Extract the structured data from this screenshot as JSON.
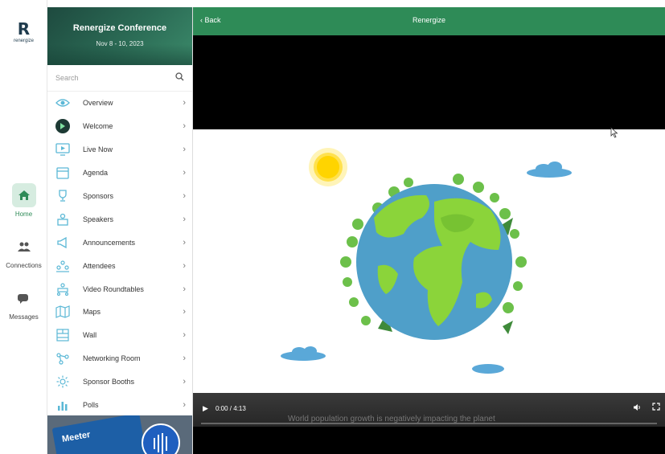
{
  "rail": {
    "logo_text": "renergize",
    "items": [
      {
        "label": "Home",
        "icon": "home-icon"
      },
      {
        "label": "Connections",
        "icon": "people-icon"
      },
      {
        "label": "Messages",
        "icon": "chat-icon"
      }
    ]
  },
  "panel": {
    "event_title": "Renergize Conference",
    "event_dates": "Nov 8 - 10, 2023",
    "search_placeholder": "Search",
    "menu": [
      {
        "label": "Overview",
        "icon": "eye-icon"
      },
      {
        "label": "Welcome",
        "icon": "welcome-logo-icon"
      },
      {
        "label": "Live Now",
        "icon": "monitor-icon"
      },
      {
        "label": "Agenda",
        "icon": "calendar-icon"
      },
      {
        "label": "Sponsors",
        "icon": "trophy-icon"
      },
      {
        "label": "Speakers",
        "icon": "podium-icon"
      },
      {
        "label": "Announcements",
        "icon": "megaphone-icon"
      },
      {
        "label": "Attendees",
        "icon": "attendees-icon"
      },
      {
        "label": "Video Roundtables",
        "icon": "roundtable-icon"
      },
      {
        "label": "Maps",
        "icon": "map-icon"
      },
      {
        "label": "Wall",
        "icon": "wall-icon"
      },
      {
        "label": "Networking Room",
        "icon": "networking-icon"
      },
      {
        "label": "Sponsor Booths",
        "icon": "booth-icon"
      },
      {
        "label": "Polls",
        "icon": "poll-icon"
      }
    ],
    "promo_text": "Meeter"
  },
  "topbar": {
    "back_label": "Back",
    "title": "Renergize"
  },
  "video": {
    "time": "0:00 / 4:13",
    "subtitle": "World population growth is negatively impacting the planet",
    "progress": 0.0
  },
  "colors": {
    "accent": "#2e8b57",
    "icon_tint": "#5bb8d6",
    "ocean": "#4f9fc9",
    "land": "#8bd43a"
  }
}
